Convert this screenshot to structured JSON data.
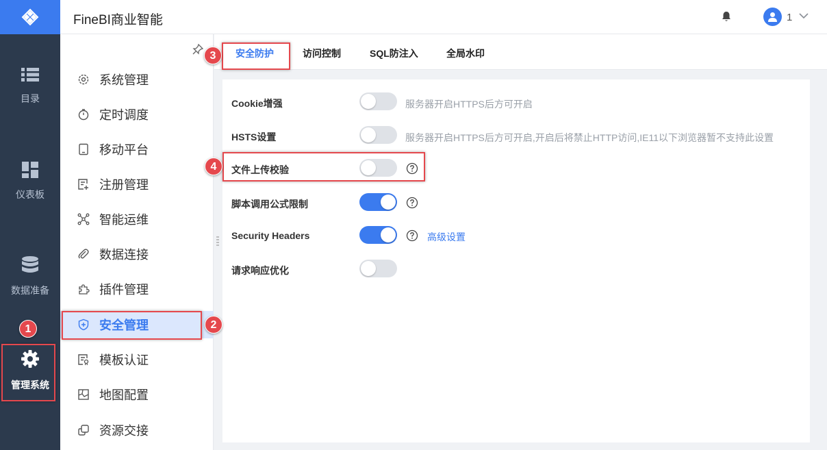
{
  "app": {
    "title": "FineBI商业智能"
  },
  "user": {
    "name": "1"
  },
  "rail": {
    "items": [
      {
        "label": "目录",
        "icon": "list-icon"
      },
      {
        "label": "仪表板",
        "icon": "dashboard-icon"
      },
      {
        "label": "数据准备",
        "icon": "database-icon"
      },
      {
        "label": "管理系统",
        "icon": "gear-icon",
        "active": true
      }
    ]
  },
  "menu": {
    "items": [
      {
        "label": "系统管理",
        "icon": "gear-outline-icon"
      },
      {
        "label": "定时调度",
        "icon": "timer-icon"
      },
      {
        "label": "移动平台",
        "icon": "tablet-icon"
      },
      {
        "label": "注册管理",
        "icon": "register-icon"
      },
      {
        "label": "智能运维",
        "icon": "network-icon"
      },
      {
        "label": "数据连接",
        "icon": "paperclip-icon"
      },
      {
        "label": "插件管理",
        "icon": "puzzle-icon"
      },
      {
        "label": "安全管理",
        "icon": "shield-icon",
        "active": true
      },
      {
        "label": "模板认证",
        "icon": "certificate-icon"
      },
      {
        "label": "地图配置",
        "icon": "map-icon"
      },
      {
        "label": "资源交接",
        "icon": "transfer-icon"
      }
    ]
  },
  "tabs": [
    {
      "label": "安全防护",
      "active": true
    },
    {
      "label": "访问控制"
    },
    {
      "label": "SQL防注入"
    },
    {
      "label": "全局水印"
    }
  ],
  "settings": [
    {
      "label": "Cookie增强",
      "enabled": false,
      "hint": "服务器开启HTTPS后方可开启"
    },
    {
      "label": "HSTS设置",
      "enabled": false,
      "hint": "服务器开启HTTPS后方可开启,开启后将禁止HTTP访问,IE11以下浏览器暂不支持此设置"
    },
    {
      "label": "文件上传校验",
      "enabled": false,
      "help": true
    },
    {
      "label": "脚本调用公式限制",
      "enabled": true,
      "help": true
    },
    {
      "label": "Security Headers",
      "enabled": true,
      "help": true,
      "link": "高级设置"
    },
    {
      "label": "请求响应优化",
      "enabled": false
    }
  ],
  "annotations": [
    "1",
    "2",
    "3",
    "4"
  ],
  "colors": {
    "accent": "#3b7bef",
    "rail_bg": "#2c3a4d",
    "annotation": "#e5484d",
    "toggle_off": "#dfe2e7"
  }
}
